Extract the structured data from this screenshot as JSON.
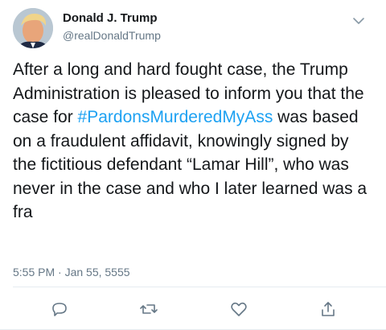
{
  "author": {
    "display_name": "Donald J. Trump",
    "handle": "@realDonaldTrump"
  },
  "tweet": {
    "text_before": "After a long and hard fought case, the Trump Administration is pleased to inform you that the case for ",
    "hashtag": "#PardonsMurderedMyAss",
    "text_after": " was based on a fraudulent affidavit, knowingly signed by the fictitious defendant “Lamar Hill”, who was never in the case and who I later learned was a fra",
    "timestamp": "5:55 PM · Jan 55, 5555"
  },
  "icons": {
    "menu": "chevron-down-icon",
    "reply": "reply-icon",
    "retweet": "retweet-icon",
    "like": "heart-icon",
    "share": "share-icon"
  },
  "colors": {
    "text": "#14171a",
    "secondary": "#657786",
    "link": "#1da1f2",
    "divider": "#e6ecf0"
  }
}
